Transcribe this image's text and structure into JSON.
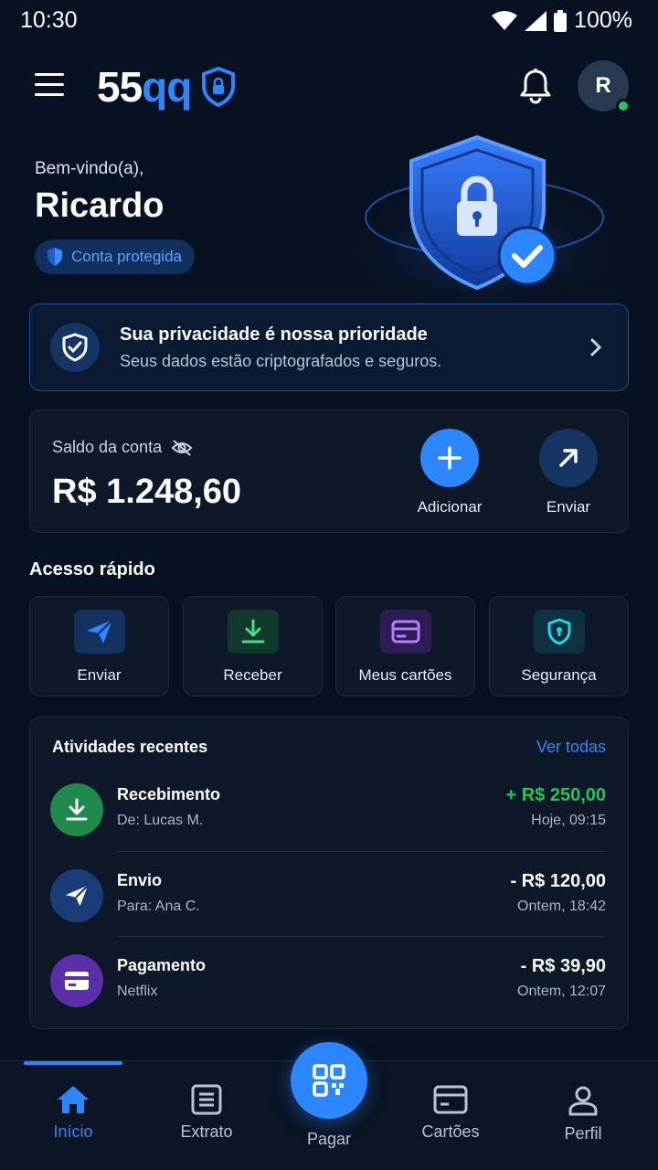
{
  "status_bar": {
    "time": "10:30",
    "battery": "100%"
  },
  "header": {
    "logo_white": "55",
    "logo_blue": "qq",
    "avatar_initial": "R"
  },
  "welcome": {
    "greeting": "Bem-vindo(a),",
    "name": "Ricardo",
    "badge": "Conta protegida"
  },
  "privacy": {
    "title": "Sua privacidade é nossa prioridade",
    "subtitle": "Seus dados estão criptografados e seguros."
  },
  "balance": {
    "label": "Saldo da conta",
    "value": "R$ 1.248,60",
    "actions": [
      {
        "label": "Adicionar"
      },
      {
        "label": "Enviar"
      }
    ]
  },
  "quick_access": {
    "title": "Acesso rápido",
    "items": [
      {
        "label": "Enviar",
        "icon": "send-icon"
      },
      {
        "label": "Receber",
        "icon": "download-icon"
      },
      {
        "label": "Meus cartões",
        "icon": "card-icon"
      },
      {
        "label": "Segurança",
        "icon": "shield-lock-icon"
      }
    ]
  },
  "activities": {
    "title": "Atividades recentes",
    "see_all": "Ver todas",
    "items": [
      {
        "name": "Recebimento",
        "sub": "De: Lucas M.",
        "amount": "+ R$ 250,00",
        "time": "Hoje, 09:15",
        "amount_color": "#22c55e"
      },
      {
        "name": "Envio",
        "sub": "Para: Ana C.",
        "amount": "- R$ 120,00",
        "time": "Ontem, 18:42",
        "amount_color": "#ffffff"
      },
      {
        "name": "Pagamento",
        "sub": "Netflix",
        "amount": "- R$ 39,90",
        "time": "Ontem, 12:07",
        "amount_color": "#ffffff"
      }
    ]
  },
  "bottom_nav": {
    "items": [
      {
        "label": "Início",
        "active": true
      },
      {
        "label": "Extrato"
      },
      {
        "label": "Pagar"
      },
      {
        "label": "Cartões"
      },
      {
        "label": "Perfil"
      }
    ]
  },
  "colors": {
    "accent": "#2e86ff",
    "background": "#071121",
    "positive": "#22c55e"
  }
}
